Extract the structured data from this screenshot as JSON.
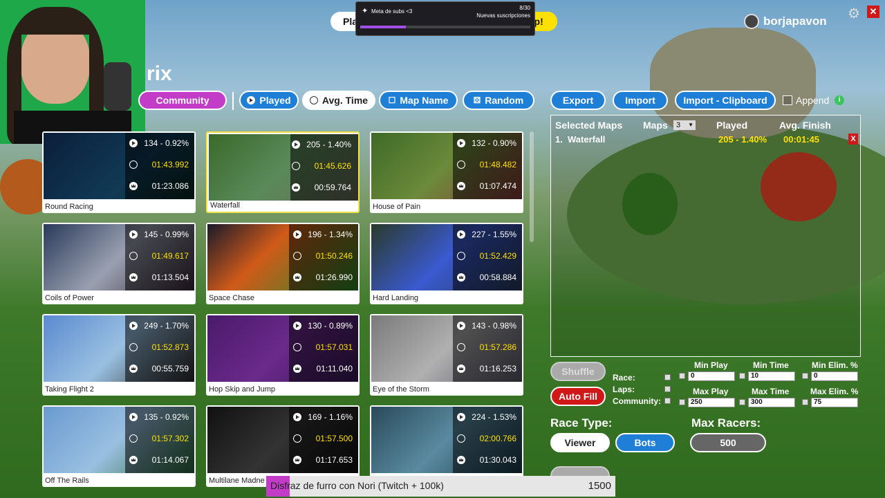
{
  "app_title_fragment": "rix",
  "top_banner": {
    "left_text": "Pla",
    "right_text": "op!"
  },
  "subs_goal": {
    "label": "Meta de subs <3",
    "count": "8/30",
    "sublabel": "Nuevas suscripciones",
    "progress": 0.27
  },
  "user": {
    "name": "borjapavon"
  },
  "filters": {
    "community": "Community",
    "played": "Played",
    "avg_time": "Avg. Time",
    "map_name": "Map Name",
    "random": "Random"
  },
  "actions": {
    "export": "Export",
    "import": "Import",
    "import_clipboard": "Import - Clipboard",
    "append": "Append"
  },
  "maps": [
    {
      "name": "Round Racing",
      "plays": "134 - 0.92%",
      "avg": "01:43.992",
      "best": "01:23.086"
    },
    {
      "name": "Waterfall",
      "plays": "205 - 1.40%",
      "avg": "01:45.626",
      "best": "00:59.764"
    },
    {
      "name": "House of Pain",
      "plays": "132 - 0.90%",
      "avg": "01:48.482",
      "best": "01:07.474"
    },
    {
      "name": "Coils of Power",
      "plays": "145 - 0.99%",
      "avg": "01:49.617",
      "best": "01:13.504"
    },
    {
      "name": "Space Chase",
      "plays": "196 - 1.34%",
      "avg": "01:50.246",
      "best": "01:26.990"
    },
    {
      "name": "Hard Landing",
      "plays": "227 - 1.55%",
      "avg": "01:52.429",
      "best": "00:58.884"
    },
    {
      "name": "Taking Flight 2",
      "plays": "249 - 1.70%",
      "avg": "01:52.873",
      "best": "00:55.759"
    },
    {
      "name": "Hop Skip and Jump",
      "plays": "130 - 0.89%",
      "avg": "01:57.031",
      "best": "01:11.040"
    },
    {
      "name": "Eye of the Storm",
      "plays": "143 - 0.98%",
      "avg": "01:57.286",
      "best": "01:16.253"
    },
    {
      "name": "Off The Rails",
      "plays": "135 - 0.92%",
      "avg": "01:57.302",
      "best": "01:14.067"
    },
    {
      "name": "Multilane Madne",
      "plays": "169 - 1.16%",
      "avg": "01:57.500",
      "best": "01:17.653"
    },
    {
      "name": "",
      "plays": "224 - 1.53%",
      "avg": "02:00.766",
      "best": "01:30.043"
    }
  ],
  "selected": {
    "headers": {
      "maps_title": "Selected Maps",
      "maps": "Maps",
      "maps_count": "3",
      "played": "Played",
      "avg_finish": "Avg. Finish"
    },
    "rows": [
      {
        "index": "1.",
        "name": "Waterfall",
        "played": "205 - 1.40%",
        "avg": "00:01:45"
      }
    ]
  },
  "controls": {
    "shuffle": "Shuffle",
    "auto_fill": "Auto Fill",
    "race": "Race:",
    "laps": "Laps:",
    "community": "Community:",
    "min_play": "Min Play",
    "min_time": "Min Time",
    "min_elim": "Min Elim. %",
    "max_play": "Max Play",
    "max_time": "Max Time",
    "max_elim": "Max Elim. %",
    "min_play_val": "0",
    "min_time_val": "10",
    "min_elim_val": "0",
    "max_play_val": "250",
    "max_time_val": "300",
    "max_elim_val": "75",
    "race_type": "Race Type:",
    "viewer": "Viewer",
    "bots": "Bots",
    "max_racers": "Max Racers:",
    "max_racers_val": "500"
  },
  "ticker": {
    "text": "Disfraz de furro con Nori (Twitch + 100k)",
    "overlap": "k)",
    "amount": "1500"
  },
  "colors": {
    "accent_blue": "#1f7fd6",
    "pink": "#c23cc8",
    "yellow": "#ffe000",
    "red": "#d01818"
  }
}
